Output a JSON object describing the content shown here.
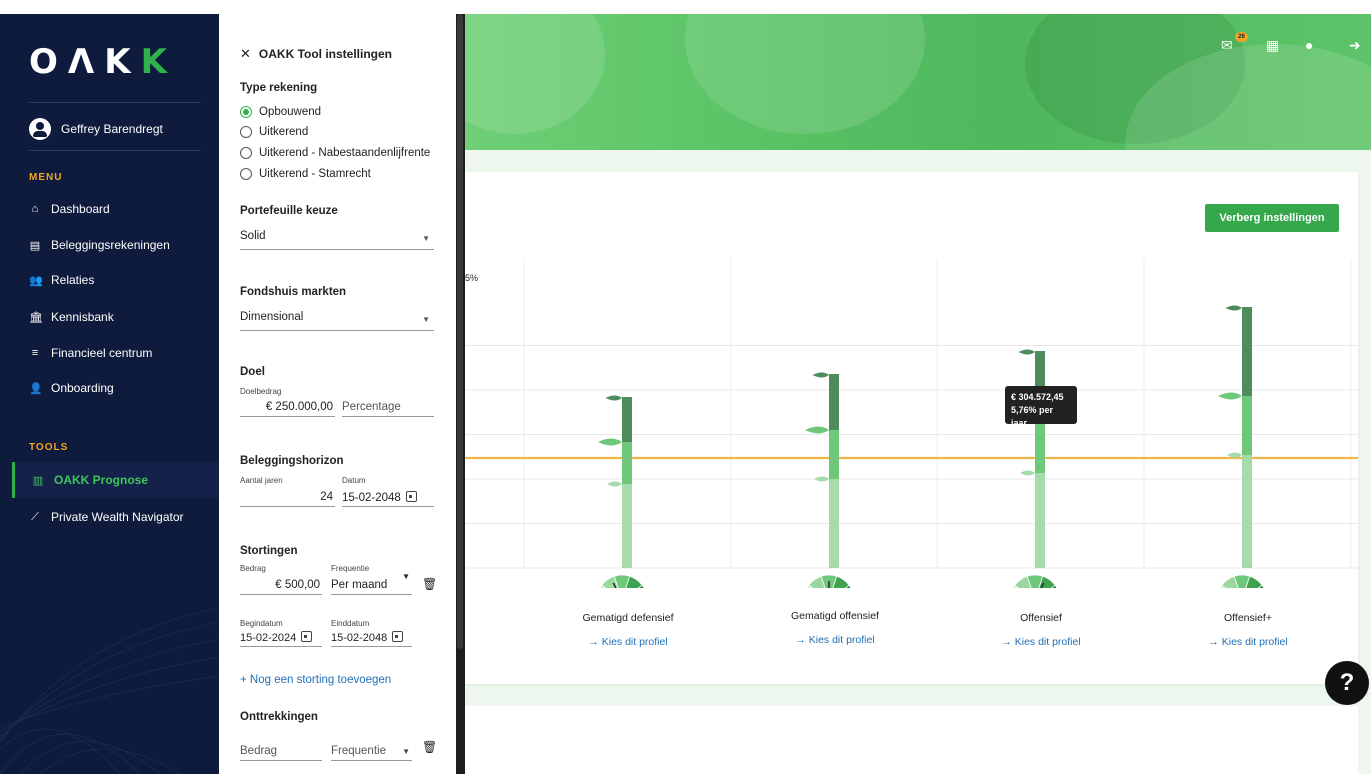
{
  "nav": {
    "logo": [
      "O",
      "Λ",
      "K",
      "K"
    ],
    "user": "Geffrey Barendregt",
    "menu_header": "MENU",
    "menu": [
      {
        "label": "Dashboard",
        "icon": "home-icon"
      },
      {
        "label": "Beleggingsrekeningen",
        "icon": "document-icon"
      },
      {
        "label": "Relaties",
        "icon": "users-icon"
      },
      {
        "label": "Kennisbank",
        "icon": "bank-icon"
      },
      {
        "label": "Financieel centrum",
        "icon": "coins-icon"
      },
      {
        "label": "Onboarding",
        "icon": "user-plus-icon"
      }
    ],
    "tools_header": "TOOLS",
    "tools": [
      {
        "label": "OAKK Prognose",
        "icon": "bar-chart-icon",
        "active": true
      },
      {
        "label": "Private Wealth Navigator",
        "icon": "line-chart-icon",
        "active": false
      }
    ]
  },
  "panel": {
    "title": "OAKK Tool instellingen",
    "type_label": "Type rekening",
    "types": [
      "Opbouwend",
      "Uitkerend",
      "Uitkerend - Nabestaandenlijfrente",
      "Uitkerend - Stamrecht"
    ],
    "portfolio_label": "Portefeuille keuze",
    "portfolio_value": "Solid",
    "markets_label": "Fondshuis markten",
    "markets_value": "Dimensional",
    "goal_label": "Doel",
    "goal_amount_label": "Doelbedrag",
    "goal_amount": "€ 250.000,00",
    "goal_percentage_placeholder": "Percentage",
    "horizon_label": "Beleggingshorizon",
    "years_label": "Aantal jaren",
    "years": "24",
    "date_label": "Datum",
    "date": "15-02-2048",
    "deposits_label": "Stortingen",
    "amount_label": "Bedrag",
    "deposit_amount": "€ 500,00",
    "frequency_label": "Frequentie",
    "frequency": "Per maand",
    "start_label": "Begindatum",
    "start_date": "15-02-2024",
    "end_label": "Einddatum",
    "end_date": "15-02-2048",
    "add_deposit": "+ Nog een storting toevoegen",
    "withdrawals_label": "Onttrekkingen",
    "withdraw_amount_ph": "Bedrag",
    "withdraw_freq_ph": "Frequentie"
  },
  "header": {
    "mail_count": "26"
  },
  "main": {
    "hide_button": "Verberg instellingen",
    "axis_fragment": "5%",
    "tooltip_value": "€ 304.572,45",
    "tooltip_rate": "5,76% per jaar",
    "profile_link": "Kies dit profiel",
    "help": "?"
  },
  "chart_data": {
    "type": "bar",
    "categories": [
      "Gematigd defensief",
      "Gematigd offensief",
      "Offensief",
      "Offensief+"
    ],
    "series": [
      {
        "values": [
          84,
          89,
          95,
          113
        ]
      },
      {
        "values": [
          126,
          138,
          150,
          172
        ]
      },
      {
        "values": [
          170,
          193,
          216,
          260
        ]
      }
    ],
    "target_line": 250000,
    "gauge_levels": [
      0.35,
      0.5,
      0.65,
      0.85
    ],
    "colors": {
      "bar_light": "#a7dbac",
      "bar_mid": "#6fc77a",
      "bar_dark": "#4f8c5c",
      "target": "#f0b64a"
    }
  }
}
